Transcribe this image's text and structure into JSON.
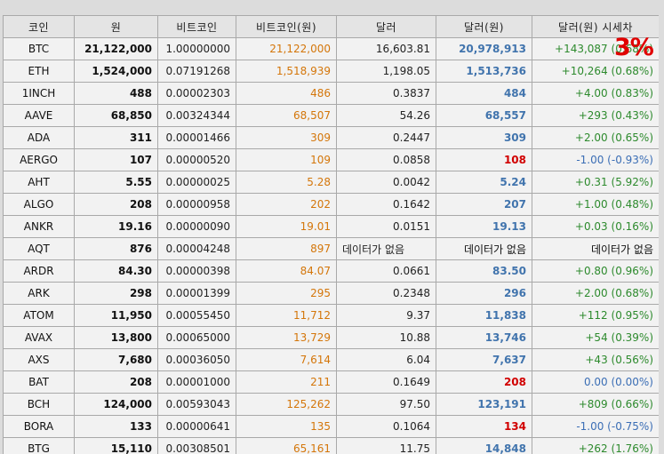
{
  "headers": {
    "coin": "코인",
    "won": "원",
    "btc": "비트코인",
    "btc_krw": "비트코인(원)",
    "usd": "달러",
    "usd_krw": "달러(원)",
    "premium": "달러(원) 시세차"
  },
  "overlay_badge": "3%",
  "colors": {
    "btc_krw": "#d4760a",
    "usd_krw_up": "#4174ad",
    "usd_krw_down": "#d10000",
    "premium_up": "#2d8a2d",
    "premium_down": "#3b6eb5",
    "badge": "#e00000"
  },
  "rows": [
    {
      "coin": "BTC",
      "won": "21,122,000",
      "btc": "1.00000000",
      "btc_krw": "21,122,000",
      "usd": "16,603.81",
      "usd_krw": "20,978,913",
      "premium": "+143,087 (0.68%)",
      "dir": "up"
    },
    {
      "coin": "ETH",
      "won": "1,524,000",
      "btc": "0.07191268",
      "btc_krw": "1,518,939",
      "usd": "1,198.05",
      "usd_krw": "1,513,736",
      "premium": "+10,264 (0.68%)",
      "dir": "up"
    },
    {
      "coin": "1INCH",
      "won": "488",
      "btc": "0.00002303",
      "btc_krw": "486",
      "usd": "0.3837",
      "usd_krw": "484",
      "premium": "+4.00 (0.83%)",
      "dir": "up"
    },
    {
      "coin": "AAVE",
      "won": "68,850",
      "btc": "0.00324344",
      "btc_krw": "68,507",
      "usd": "54.26",
      "usd_krw": "68,557",
      "premium": "+293 (0.43%)",
      "dir": "up"
    },
    {
      "coin": "ADA",
      "won": "311",
      "btc": "0.00001466",
      "btc_krw": "309",
      "usd": "0.2447",
      "usd_krw": "309",
      "premium": "+2.00 (0.65%)",
      "dir": "up"
    },
    {
      "coin": "AERGO",
      "won": "107",
      "btc": "0.00000520",
      "btc_krw": "109",
      "usd": "0.0858",
      "usd_krw": "108",
      "premium": "-1.00 (-0.93%)",
      "dir": "down"
    },
    {
      "coin": "AHT",
      "won": "5.55",
      "btc": "0.00000025",
      "btc_krw": "5.28",
      "usd": "0.0042",
      "usd_krw": "5.24",
      "premium": "+0.31 (5.92%)",
      "dir": "up"
    },
    {
      "coin": "ALGO",
      "won": "208",
      "btc": "0.00000958",
      "btc_krw": "202",
      "usd": "0.1642",
      "usd_krw": "207",
      "premium": "+1.00 (0.48%)",
      "dir": "up"
    },
    {
      "coin": "ANKR",
      "won": "19.16",
      "btc": "0.00000090",
      "btc_krw": "19.01",
      "usd": "0.0151",
      "usd_krw": "19.13",
      "premium": "+0.03 (0.16%)",
      "dir": "up"
    },
    {
      "coin": "AQT",
      "won": "876",
      "btc": "0.00004248",
      "btc_krw": "897",
      "usd": "데이터가 없음",
      "usd_krw": "데이터가 없음",
      "premium": "데이터가 없음",
      "dir": "none"
    },
    {
      "coin": "ARDR",
      "won": "84.30",
      "btc": "0.00000398",
      "btc_krw": "84.07",
      "usd": "0.0661",
      "usd_krw": "83.50",
      "premium": "+0.80 (0.96%)",
      "dir": "up"
    },
    {
      "coin": "ARK",
      "won": "298",
      "btc": "0.00001399",
      "btc_krw": "295",
      "usd": "0.2348",
      "usd_krw": "296",
      "premium": "+2.00 (0.68%)",
      "dir": "up"
    },
    {
      "coin": "ATOM",
      "won": "11,950",
      "btc": "0.00055450",
      "btc_krw": "11,712",
      "usd": "9.37",
      "usd_krw": "11,838",
      "premium": "+112 (0.95%)",
      "dir": "up"
    },
    {
      "coin": "AVAX",
      "won": "13,800",
      "btc": "0.00065000",
      "btc_krw": "13,729",
      "usd": "10.88",
      "usd_krw": "13,746",
      "premium": "+54 (0.39%)",
      "dir": "up"
    },
    {
      "coin": "AXS",
      "won": "7,680",
      "btc": "0.00036050",
      "btc_krw": "7,614",
      "usd": "6.04",
      "usd_krw": "7,637",
      "premium": "+43 (0.56%)",
      "dir": "up"
    },
    {
      "coin": "BAT",
      "won": "208",
      "btc": "0.00001000",
      "btc_krw": "211",
      "usd": "0.1649",
      "usd_krw": "208",
      "premium": "0.00 (0.00%)",
      "dir": "flat"
    },
    {
      "coin": "BCH",
      "won": "124,000",
      "btc": "0.00593043",
      "btc_krw": "125,262",
      "usd": "97.50",
      "usd_krw": "123,191",
      "premium": "+809 (0.66%)",
      "dir": "up"
    },
    {
      "coin": "BORA",
      "won": "133",
      "btc": "0.00000641",
      "btc_krw": "135",
      "usd": "0.1064",
      "usd_krw": "134",
      "premium": "-1.00 (-0.75%)",
      "dir": "down"
    },
    {
      "coin": "BTG",
      "won": "15,110",
      "btc": "0.00308501",
      "btc_krw": "65,161",
      "usd": "11.75",
      "usd_krw": "14,848",
      "premium": "+262 (1.76%)",
      "dir": "up"
    }
  ]
}
